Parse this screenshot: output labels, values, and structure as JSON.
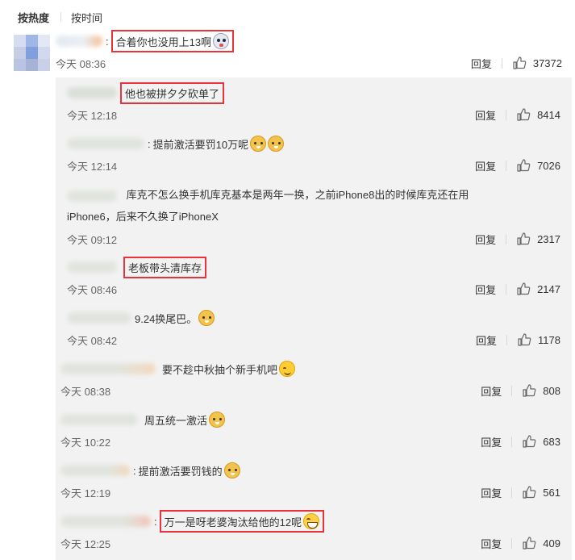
{
  "sort": {
    "hot": "按热度",
    "time": "按时间"
  },
  "top": {
    "text": "合着你也没用上13啊",
    "time": "今天 08:36",
    "reply": "回复",
    "likes": "37372"
  },
  "replies": [
    {
      "text": "他也被拼夕夕砍单了",
      "time": "今天 12:18",
      "reply": "回复",
      "likes": "8414"
    },
    {
      "text": "提前激活要罚10万呢",
      "time": "今天 12:14",
      "reply": "回复",
      "likes": "7026"
    },
    {
      "text1": "库克不怎么换手机库克基本是两年一换，之前iPhone8出的时候库克还在用",
      "text2": "iPhone6，后来不久换了iPhoneX",
      "time": "今天 09:12",
      "reply": "回复",
      "likes": "2317"
    },
    {
      "text": "老板带头清库存",
      "time": "今天 08:46",
      "reply": "回复",
      "likes": "2147"
    },
    {
      "text": "9.24换尾巴。",
      "time": "今天 08:42",
      "reply": "回复",
      "likes": "1178"
    },
    {
      "text": "要不趁中秋抽个新手机吧",
      "time": "今天 08:38",
      "reply": "回复",
      "likes": "808"
    },
    {
      "text": "周五统一激活",
      "time": "今天 10:22",
      "reply": "回复",
      "likes": "683"
    },
    {
      "text": "提前激活要罚钱的",
      "time": "今天 12:19",
      "reply": "回复",
      "likes": "561"
    },
    {
      "text": "万一是呀老婆淘汰给他的12呢",
      "time": "今天 12:25",
      "reply": "回复",
      "likes": "409"
    }
  ],
  "icons": {
    "like": "thumbs-up-icon",
    "emoji_ghost": "ghost-face-icon",
    "emoji_cat": "cat-face-icon",
    "emoji_smile": "smile-face-icon",
    "emoji_laugh": "laughing-face-icon"
  },
  "colors": {
    "highlight_border": "#e8333c",
    "reply_bg": "#f2f2f2"
  }
}
